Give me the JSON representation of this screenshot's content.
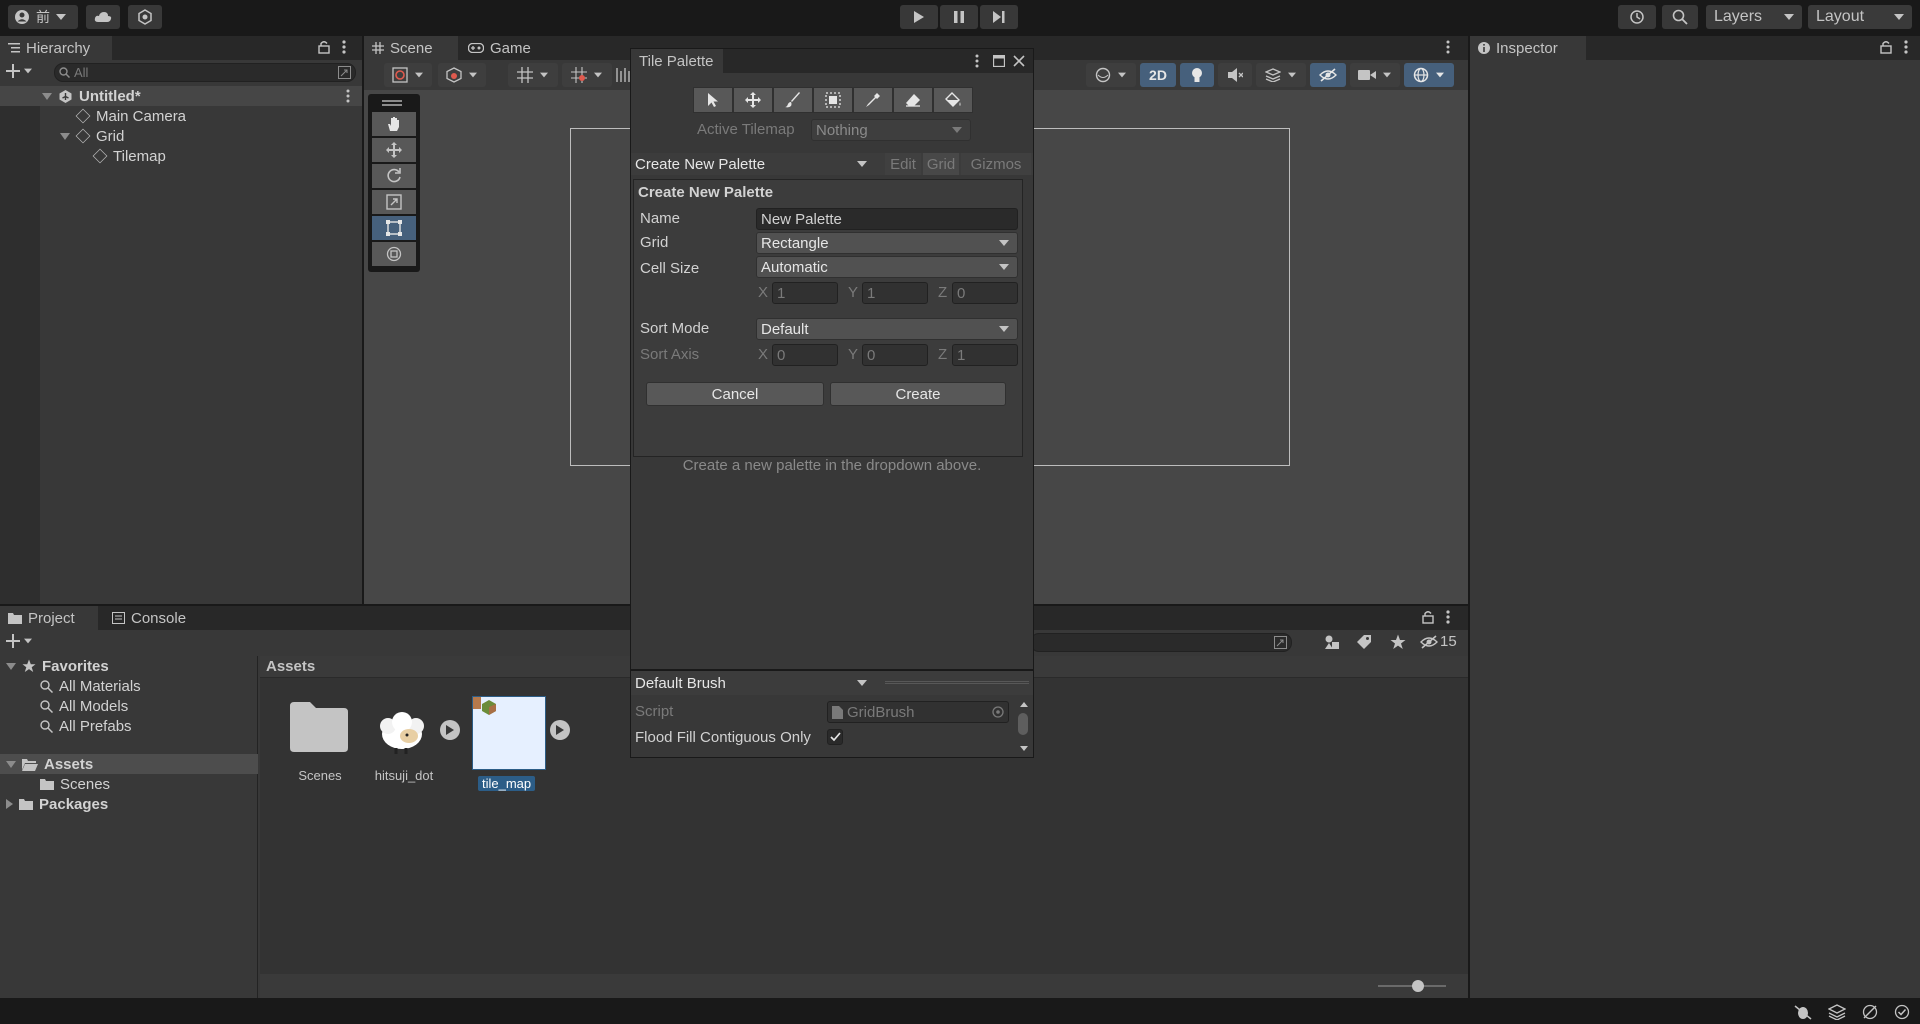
{
  "toolbar": {
    "account_label": "前",
    "layers_label": "Layers",
    "layout_label": "Layout"
  },
  "hierarchy": {
    "tab_label": "Hierarchy",
    "search_placeholder": "All",
    "items": [
      {
        "label": "Untitled*"
      },
      {
        "label": "Main Camera"
      },
      {
        "label": "Grid"
      },
      {
        "label": "Tilemap"
      }
    ]
  },
  "scene": {
    "tabs": [
      "Scene",
      "Game"
    ],
    "mode_2d": "2D"
  },
  "inspector": {
    "tab_label": "Inspector"
  },
  "tile_palette": {
    "title": "Tile Palette",
    "active_tilemap_label": "Active Tilemap",
    "active_tilemap_value": "Nothing",
    "palette_dropdown": "Create New Palette",
    "edit_label": "Edit",
    "grid_label": "Grid",
    "gizmos_label": "Gizmos",
    "create_header": "Create New Palette",
    "name_label": "Name",
    "name_value": "New Palette",
    "grid_field_label": "Grid",
    "grid_value": "Rectangle",
    "cell_size_label": "Cell Size",
    "cell_size_value": "Automatic",
    "cell_x": "1",
    "cell_y": "1",
    "cell_z": "0",
    "sort_mode_label": "Sort Mode",
    "sort_mode_value": "Default",
    "sort_axis_label": "Sort Axis",
    "axis_x": "0",
    "axis_y": "0",
    "axis_z": "1",
    "x": "X",
    "y": "Y",
    "z": "Z",
    "cancel_label": "Cancel",
    "create_label": "Create",
    "empty_message": "Create a new palette in the dropdown above.",
    "brush_dropdown": "Default Brush",
    "script_label": "Script",
    "script_value": "GridBrush",
    "flood_fill_label": "Flood Fill Contiguous Only",
    "flood_fill_checked": true
  },
  "project": {
    "tabs": [
      "Project",
      "Console"
    ],
    "hidden_count": "15",
    "favorites_label": "Favorites",
    "favorites": [
      "All Materials",
      "All Models",
      "All Prefabs"
    ],
    "assets_label": "Assets",
    "assets_children": [
      "Scenes"
    ],
    "packages_label": "Packages",
    "breadcrumb": "Assets",
    "files": [
      {
        "name": "Scenes"
      },
      {
        "name": "hitsuji_dot"
      },
      {
        "name": "tile_map"
      }
    ]
  },
  "colors": {
    "selection_blue": "#2c5d87",
    "tile_map_bg": "#e6f0ff",
    "active_tool_blue": "#46607c"
  }
}
